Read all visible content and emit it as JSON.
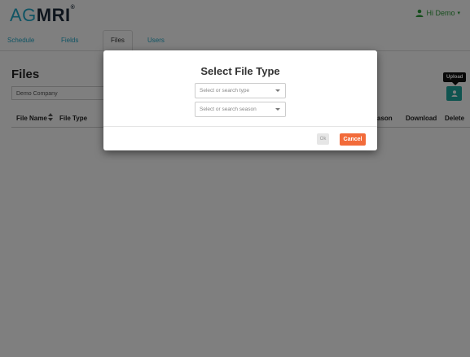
{
  "header": {
    "logo_ag": "AG",
    "logo_mri": "MRI",
    "logo_reg": "®",
    "user_greeting": "Hi Demo",
    "user_caret": "▾"
  },
  "tabs": [
    {
      "label": "Schedule",
      "active": false
    },
    {
      "label": "Fields",
      "active": false
    },
    {
      "label": "Files",
      "active": true
    },
    {
      "label": "Users",
      "active": false
    }
  ],
  "main": {
    "title": "Files",
    "company_select_value": "Demo Company",
    "upload_tooltip": "Upload"
  },
  "table": {
    "columns": [
      "File Name",
      "File Type",
      "ason",
      "Download",
      "Delete"
    ]
  },
  "modal": {
    "title": "Select File Type",
    "type_placeholder": "Select or search type",
    "season_placeholder": "Select or search season",
    "ok_label": "Ok",
    "cancel_label": "Cancel"
  },
  "colors": {
    "accent": "#20a8c8",
    "upload_button": "#21a9a0",
    "cancel_button": "#f26b3a",
    "user_green": "#2e9c3a"
  }
}
